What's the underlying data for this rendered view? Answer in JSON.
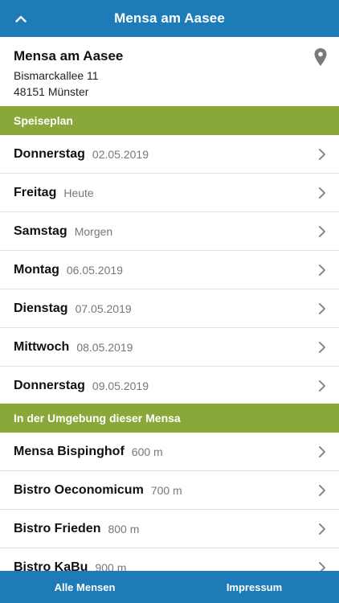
{
  "header": {
    "title": "Mensa am Aasee"
  },
  "info": {
    "name": "Mensa am Aasee",
    "street": "Bismarckallee 11",
    "city": "48151 Münster"
  },
  "sections": {
    "speiseplan": "Speiseplan",
    "nearby": "In der Umgebung dieser Mensa"
  },
  "days": [
    {
      "day": "Donnerstag",
      "date": "02.05.2019"
    },
    {
      "day": "Freitag",
      "date": "Heute"
    },
    {
      "day": "Samstag",
      "date": "Morgen"
    },
    {
      "day": "Montag",
      "date": "06.05.2019"
    },
    {
      "day": "Dienstag",
      "date": "07.05.2019"
    },
    {
      "day": "Mittwoch",
      "date": "08.05.2019"
    },
    {
      "day": "Donnerstag",
      "date": "09.05.2019"
    }
  ],
  "nearby": [
    {
      "name": "Mensa Bispinghof",
      "distance": "600 m"
    },
    {
      "name": "Bistro Oeconomicum",
      "distance": "700 m"
    },
    {
      "name": "Bistro Frieden",
      "distance": "800 m"
    },
    {
      "name": "Bistro KaBu",
      "distance": "900 m"
    }
  ],
  "footer": {
    "all_label": "Alle Mensen",
    "imprint_label": "Impressum"
  }
}
